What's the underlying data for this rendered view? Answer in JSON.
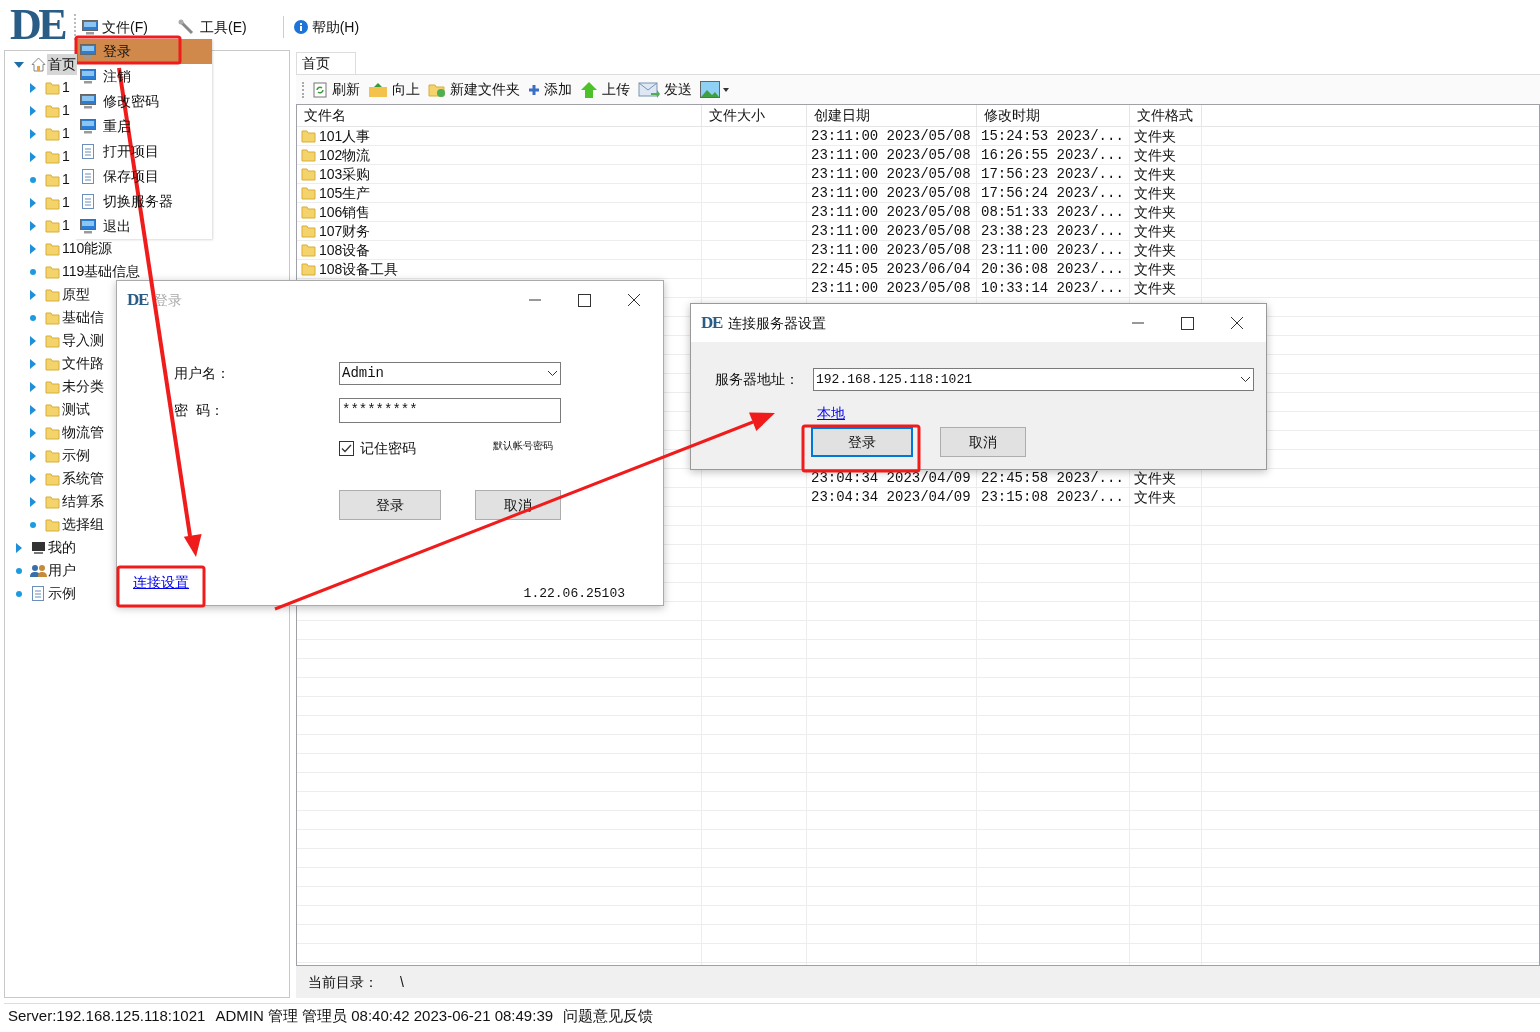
{
  "app": {
    "logo": "DE"
  },
  "menubar": [
    {
      "label": "文件(F)"
    },
    {
      "label": "工具(E)"
    },
    {
      "label": "帮助(H)"
    }
  ],
  "file_menu": {
    "items": [
      {
        "label": "登录",
        "selected": true
      },
      {
        "label": "注销",
        "selected": false
      },
      {
        "label": "修改密码",
        "selected": false
      },
      {
        "label": "重启",
        "selected": false
      },
      {
        "label": "打开项目",
        "selected": false
      },
      {
        "label": "保存项目",
        "selected": false
      },
      {
        "label": "切换服务器",
        "selected": false
      },
      {
        "label": "退出",
        "selected": false
      }
    ]
  },
  "tree": {
    "items": [
      {
        "label": "首页",
        "kind": "branch",
        "expanded": true,
        "selected": true,
        "children": [
          {
            "label": "1",
            "kind": "branch",
            "expanded": false,
            "selected": false
          },
          {
            "label": "1",
            "kind": "branch",
            "expanded": false,
            "selected": false
          },
          {
            "label": "1",
            "kind": "branch",
            "expanded": false,
            "selected": false
          },
          {
            "label": "1",
            "kind": "branch",
            "expanded": false,
            "selected": false
          },
          {
            "label": "1",
            "kind": "leaf",
            "selected": false
          },
          {
            "label": "1",
            "kind": "branch",
            "expanded": false,
            "selected": false
          },
          {
            "label": "1",
            "kind": "branch",
            "expanded": false,
            "selected": false
          },
          {
            "label": "110能源",
            "kind": "branch",
            "expanded": false,
            "selected": false
          },
          {
            "label": "119基础信息",
            "kind": "leaf",
            "selected": false
          },
          {
            "label": "原型",
            "kind": "branch",
            "expanded": false,
            "selected": false
          },
          {
            "label": "基础信",
            "kind": "leaf",
            "selected": false
          },
          {
            "label": "导入测",
            "kind": "branch",
            "expanded": false,
            "selected": false
          },
          {
            "label": "文件路",
            "kind": "branch",
            "expanded": false,
            "selected": false
          },
          {
            "label": "未分类",
            "kind": "branch",
            "expanded": false,
            "selected": false
          },
          {
            "label": "测试",
            "kind": "branch",
            "expanded": false,
            "selected": false
          },
          {
            "label": "物流管",
            "kind": "branch",
            "expanded": false,
            "selected": false
          },
          {
            "label": "示例",
            "kind": "branch",
            "expanded": false,
            "selected": false
          },
          {
            "label": "系统管",
            "kind": "branch",
            "expanded": false,
            "selected": false
          },
          {
            "label": "结算系",
            "kind": "branch",
            "expanded": false,
            "selected": false
          },
          {
            "label": "选择组",
            "kind": "leaf",
            "selected": false
          }
        ]
      },
      {
        "label": "我的",
        "kind": "branch",
        "expanded": false,
        "selected": false
      },
      {
        "label": "用户",
        "kind": "leaf",
        "selected": false
      },
      {
        "label": "示例",
        "kind": "leaf",
        "selected": false
      }
    ]
  },
  "tabs": [
    {
      "label": "首页",
      "selected": true
    }
  ],
  "toolbar": [
    {
      "label": "刷新"
    },
    {
      "label": "向上"
    },
    {
      "label": "新建文件夹"
    },
    {
      "label": "添加"
    },
    {
      "label": "上传"
    },
    {
      "label": "发送"
    }
  ],
  "table": {
    "columns": [
      "文件名",
      "文件大小",
      "创建日期",
      "修改时期",
      "文件格式"
    ],
    "rows": [
      {
        "name": "101人事",
        "created": "23:11:00 2023/05/08",
        "modified": "15:24:53 2023/...",
        "format": "文件夹"
      },
      {
        "name": "102物流",
        "created": "23:11:00 2023/05/08",
        "modified": "16:26:55 2023/...",
        "format": "文件夹"
      },
      {
        "name": "103采购",
        "created": "23:11:00 2023/05/08",
        "modified": "17:56:23 2023/...",
        "format": "文件夹"
      },
      {
        "name": "105生产",
        "created": "23:11:00 2023/05/08",
        "modified": "17:56:24 2023/...",
        "format": "文件夹"
      },
      {
        "name": "106销售",
        "created": "23:11:00 2023/05/08",
        "modified": "08:51:33 2023/...",
        "format": "文件夹"
      },
      {
        "name": "107财务",
        "created": "23:11:00 2023/05/08",
        "modified": "23:38:23 2023/...",
        "format": "文件夹"
      },
      {
        "name": "108设备",
        "created": "23:11:00 2023/05/08",
        "modified": "23:11:00 2023/...",
        "format": "文件夹"
      },
      {
        "name": "108设备工具",
        "created": "22:45:05 2023/06/04",
        "modified": "20:36:08 2023/...",
        "format": "文件夹"
      },
      {
        "created": "23:11:00 2023/05/08",
        "modified": "10:33:14 2023/...",
        "format": "文件夹"
      }
    ],
    "lower_rows": [
      {
        "created": "23:04:34 2023/04/09",
        "modified": "22:45:58 2023/...",
        "format": "文件夹"
      },
      {
        "created": "23:04:34 2023/04/09",
        "modified": "23:15:08 2023/...",
        "format": "文件夹"
      }
    ]
  },
  "path_bar": {
    "label": "当前目录：",
    "value": "\\"
  },
  "status_bar": {
    "items": [
      "Server:192.168.125.118:1021",
      "ADMIN 管理 管理员 08:40:42 2023-06-21 08:49:39",
      "问题意见反馈"
    ]
  },
  "login_dialog": {
    "icon": "DE",
    "title": "登录",
    "active": false,
    "username_label": "用户名：",
    "username": "Admin",
    "password_label": "密  码：",
    "password": "*********",
    "remember": {
      "label": "记住密码",
      "checked": true
    },
    "default_hint": "默认帐号密码",
    "buttons": [
      {
        "label": "登录",
        "focused": false
      },
      {
        "label": "取消",
        "focused": false
      }
    ],
    "link": "连接设置",
    "version": "1.22.06.25103"
  },
  "server_dialog": {
    "icon": "DE",
    "title": "连接服务器设置",
    "active": true,
    "address_label": "服务器地址：",
    "address": "192.168.125.118:1021",
    "link": "本地",
    "buttons": [
      {
        "label": "登录",
        "focused": true
      },
      {
        "label": "取消",
        "focused": false
      }
    ]
  }
}
